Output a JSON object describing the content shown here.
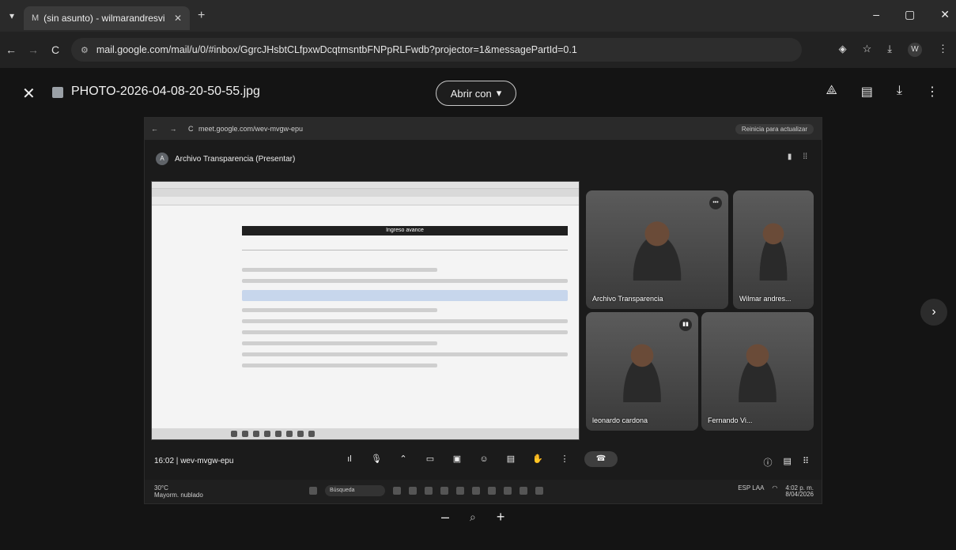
{
  "browser": {
    "tab": {
      "title": "(sin asunto) - wilmarandresvi",
      "close": "✕"
    },
    "new_tab": "+",
    "window_controls": {
      "minimize": "–",
      "maximize": "▢",
      "close": "✕"
    },
    "nav": {
      "back": "←",
      "forward": "→",
      "reload": "C"
    },
    "url": "mail.google.com/mail/u/0/#inbox/GgrcJHsbtCLfpxwDcqtmsntbFNPpRLFwdb?projector=1&messagePartId=0.1",
    "profile_initial": "W"
  },
  "viewer": {
    "close": "✕",
    "filename": "PHOTO-2026-04-08-20-50-55.jpg",
    "open_with": "Abrir con",
    "actions": [
      "add-to-drive",
      "print",
      "download",
      "more"
    ]
  },
  "photo": {
    "inner_url": "meet.google.com/wev-mvgw-epu",
    "inner_reload_label": "Reinicia para actualizar",
    "meet_title": "Archivo Transparencia (Presentar)",
    "meet_avatar": "A",
    "shared_doc_header": "Ingreso avance",
    "participants": [
      {
        "name": "Archivo Transparencia",
        "badge": "•••"
      },
      {
        "name": "Wilmar andres...",
        "badge": ""
      },
      {
        "name": "leonardo cardona",
        "badge": "▮▮"
      },
      {
        "name": "Fernando Vi...",
        "badge": ""
      }
    ],
    "meeting_time": "16:02",
    "meeting_code": "wev-mvgw-epu",
    "taskbar": {
      "weather_temp": "30°C",
      "weather_text": "Mayorm. nublado",
      "search": "Búsqueda",
      "lang": "ESP LAA",
      "time": "4:02 p. m.",
      "date": "8/04/2026"
    }
  },
  "zoom": {
    "out": "–",
    "in": "+"
  }
}
